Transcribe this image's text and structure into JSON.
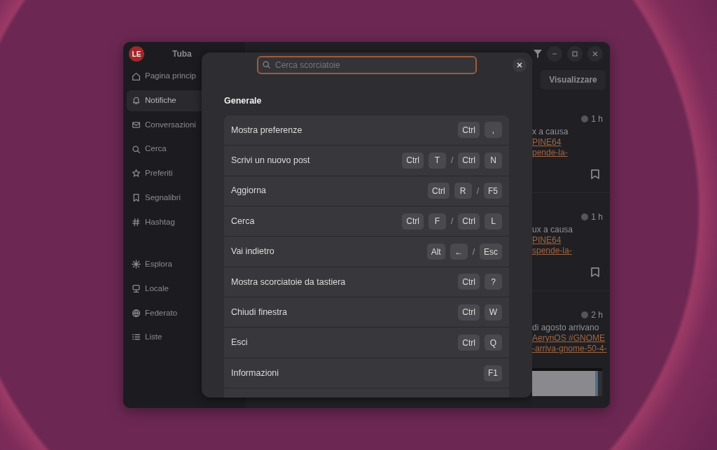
{
  "app": {
    "logo": "LE",
    "title": "Tuba"
  },
  "sidebar": {
    "sections": [
      [
        {
          "label": "Pagina princip",
          "selected": false
        },
        {
          "label": "Notifiche",
          "selected": true
        },
        {
          "label": "Conversazioni",
          "selected": false
        },
        {
          "label": "Cerca",
          "selected": false
        },
        {
          "label": "Preferiti",
          "selected": false
        },
        {
          "label": "Segnalibri",
          "selected": false
        },
        {
          "label": "Hashtag",
          "selected": false
        }
      ],
      [
        {
          "label": "Esplora",
          "selected": false
        },
        {
          "label": "Locale",
          "selected": false
        },
        {
          "label": "Federato",
          "selected": false
        },
        {
          "label": "Liste",
          "selected": false
        }
      ]
    ]
  },
  "main": {
    "view_button": "Visualizzare",
    "posts": [
      {
        "time": "1 h",
        "lines": [
          {
            "kind": "text",
            "text": "x a causa"
          },
          {
            "kind": "link",
            "text": "PINE64"
          },
          {
            "kind": "link",
            "text": "pende-la-"
          }
        ],
        "bookmarked": false
      },
      {
        "time": "1 h",
        "lines": [
          {
            "kind": "text",
            "text": "ux a causa"
          },
          {
            "kind": "link",
            "text": "PINE64"
          },
          {
            "kind": "link",
            "text": "spende-la-"
          }
        ],
        "bookmarked": false
      },
      {
        "time": "2 h",
        "lines": [
          {
            "kind": "text",
            "text": "di agosto arrivano"
          },
          {
            "kind": "link",
            "text": "AerynOS #GNOME"
          },
          {
            "kind": "link",
            "text": "-arriva-gnome-50-4-"
          },
          {
            "kind": "picture"
          }
        ]
      }
    ]
  },
  "dialog": {
    "search": {
      "placeholder": "Cerca scorciatoie"
    },
    "section_title": "Generale",
    "shortcuts": [
      {
        "action": "Mostra preferenze",
        "keys": [
          {
            "kind": "key",
            "text": "Ctrl"
          },
          {
            "kind": "key",
            "text": ","
          }
        ]
      },
      {
        "action": "Scrivi un nuovo post",
        "keys": [
          {
            "kind": "key",
            "text": "Ctrl"
          },
          {
            "kind": "key",
            "text": "T"
          },
          {
            "kind": "separator",
            "text": "/"
          },
          {
            "kind": "key",
            "text": "Ctrl"
          },
          {
            "kind": "key",
            "text": "N"
          }
        ]
      },
      {
        "action": "Aggiorna",
        "keys": [
          {
            "kind": "key",
            "text": "Ctrl"
          },
          {
            "kind": "key",
            "text": "R"
          },
          {
            "kind": "separator",
            "text": "/"
          },
          {
            "kind": "key",
            "text": "F5"
          }
        ]
      },
      {
        "action": "Cerca",
        "keys": [
          {
            "kind": "key",
            "text": "Ctrl"
          },
          {
            "kind": "key",
            "text": "F"
          },
          {
            "kind": "separator",
            "text": "/"
          },
          {
            "kind": "key",
            "text": "Ctrl"
          },
          {
            "kind": "key",
            "text": "L"
          }
        ]
      },
      {
        "action": "Vai indietro",
        "keys": [
          {
            "kind": "key",
            "text": "Alt"
          },
          {
            "kind": "key",
            "text": "←"
          },
          {
            "kind": "separator",
            "text": "/"
          },
          {
            "kind": "key",
            "text": "Esc"
          }
        ]
      },
      {
        "action": "Mostra scorciatoie da tastiera",
        "keys": [
          {
            "kind": "key",
            "text": "Ctrl"
          },
          {
            "kind": "key",
            "text": "?"
          }
        ]
      },
      {
        "action": "Chiudi finestra",
        "keys": [
          {
            "kind": "key",
            "text": "Ctrl"
          },
          {
            "kind": "key",
            "text": "W"
          }
        ]
      },
      {
        "action": "Esci",
        "keys": [
          {
            "kind": "key",
            "text": "Ctrl"
          },
          {
            "kind": "key",
            "text": "Q"
          }
        ]
      },
      {
        "action": "Informazioni",
        "keys": [
          {
            "kind": "key",
            "text": "F1"
          }
        ]
      }
    ]
  }
}
